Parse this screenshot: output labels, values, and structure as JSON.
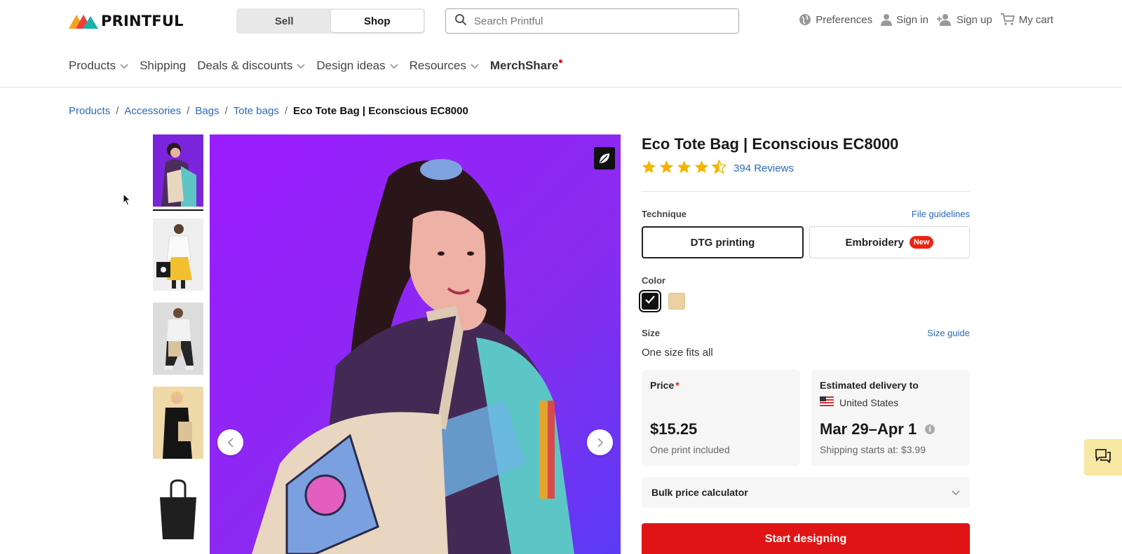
{
  "header": {
    "logo_text": "PRINTFUL",
    "toggle": {
      "sell_label": "Sell",
      "shop_label": "Shop",
      "active": "shop"
    },
    "search": {
      "placeholder": "Search Printful",
      "value": ""
    },
    "user_nav": {
      "preferences_label": "Preferences",
      "sign_in_label": "Sign in",
      "sign_up_label": "Sign up",
      "cart_label": "My cart"
    }
  },
  "main_nav": {
    "products": "Products",
    "shipping": "Shipping",
    "deals": "Deals & discounts",
    "design_ideas": "Design ideas",
    "resources": "Resources",
    "merchshare": "MerchShare"
  },
  "breadcrumb": {
    "items": [
      "Products",
      "Accessories",
      "Bags",
      "Tote bags"
    ],
    "separator": "/",
    "current": "Eco Tote Bag | Econscious EC8000"
  },
  "product": {
    "title": "Eco Tote Bag | Econscious EC8000",
    "rating": 4.5,
    "reviews_label": "394 Reviews",
    "technique": {
      "label": "Technique",
      "guidelines_link": "File guidelines",
      "options": [
        {
          "label": "DTG printing",
          "selected": true
        },
        {
          "label": "Embroidery",
          "badge": "New",
          "selected": false
        }
      ]
    },
    "color": {
      "label": "Color",
      "options": [
        {
          "name": "Black",
          "hex": "#111111",
          "selected": true
        },
        {
          "name": "Natural",
          "hex": "#ecd2a3",
          "selected": false
        }
      ]
    },
    "size": {
      "label": "Size",
      "guide_link": "Size guide",
      "value": "One size fits all"
    },
    "price_card": {
      "title": "Price",
      "required_mark": "*",
      "price": "$15.25",
      "note": "One print included"
    },
    "delivery_card": {
      "title": "Estimated delivery to",
      "country": "United States",
      "dates": "Mar 29–Apr 1",
      "shipping_note": "Shipping starts at: $3.99"
    },
    "bulk_calculator_label": "Bulk price calculator",
    "cta_label": "Start designing"
  },
  "colors": {
    "accent_red": "#e01414",
    "link_blue": "#2a6ab8",
    "star_yellow": "#f5b400",
    "chat_bg": "#f6e7a3"
  },
  "icons": {
    "search": "search-icon",
    "globe": "globe-icon",
    "user": "user-icon",
    "add_user": "add-user-icon",
    "cart": "cart-icon",
    "leaf": "leaf-icon",
    "chat": "chat-icon"
  }
}
